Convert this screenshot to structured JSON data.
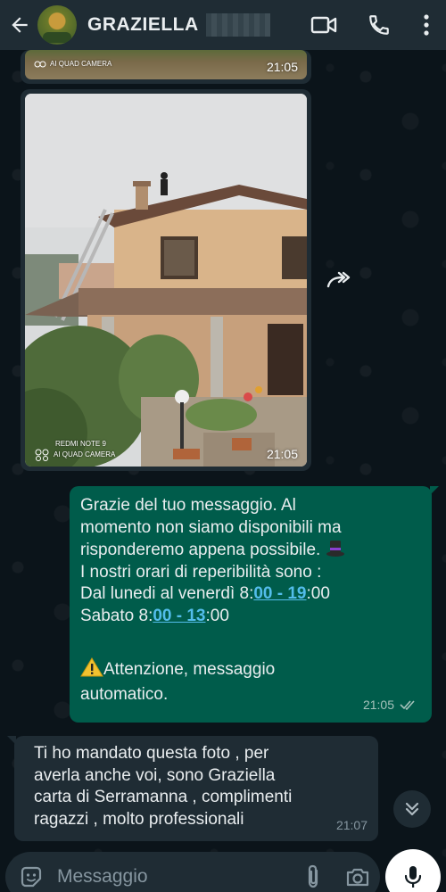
{
  "header": {
    "contact_name": "GRAZIELLA",
    "icons": [
      "back-arrow-icon",
      "avatar",
      "video-call-icon",
      "voice-call-icon",
      "more-options-icon"
    ]
  },
  "messages": {
    "image1": {
      "watermark_line2": "AI QUAD CAMERA",
      "time": "21:05"
    },
    "image2": {
      "watermark_line1": "REDMI NOTE 9",
      "watermark_line2": "AI QUAD CAMERA",
      "time": "21:05"
    },
    "outgoing": {
      "line1": "Grazie del tuo messaggio. Al",
      "line2": "momento non siamo disponibili ma",
      "line3": "risponderemo appena possibile.",
      "line4": "I nostri orari di reperibilità sono :",
      "line5_pre": "Dal lunedi al venerdì 8:",
      "line5_link": "00 - 19",
      "line5_post": ":00",
      "line6_pre": "Sabato 8:",
      "line6_link": "00 - 13",
      "line6_post": ":00",
      "line7": "Attenzione, messaggio",
      "line8": "automatico.",
      "time": "21:05",
      "status": "read"
    },
    "incoming": {
      "line1": "Ti ho mandato questa foto , per",
      "line2": "averla anche voi, sono Graziella",
      "line3": "carta di Serramanna , complimenti",
      "line4": "ragazzi , molto professionali",
      "time": "21:07"
    }
  },
  "composer": {
    "placeholder": "Messaggio"
  },
  "colors": {
    "background": "#0b141a",
    "header": "#1f2c34",
    "outgoing_bubble": "#005c4b",
    "incoming_bubble": "#1f2c34",
    "link": "#53bdeb"
  }
}
